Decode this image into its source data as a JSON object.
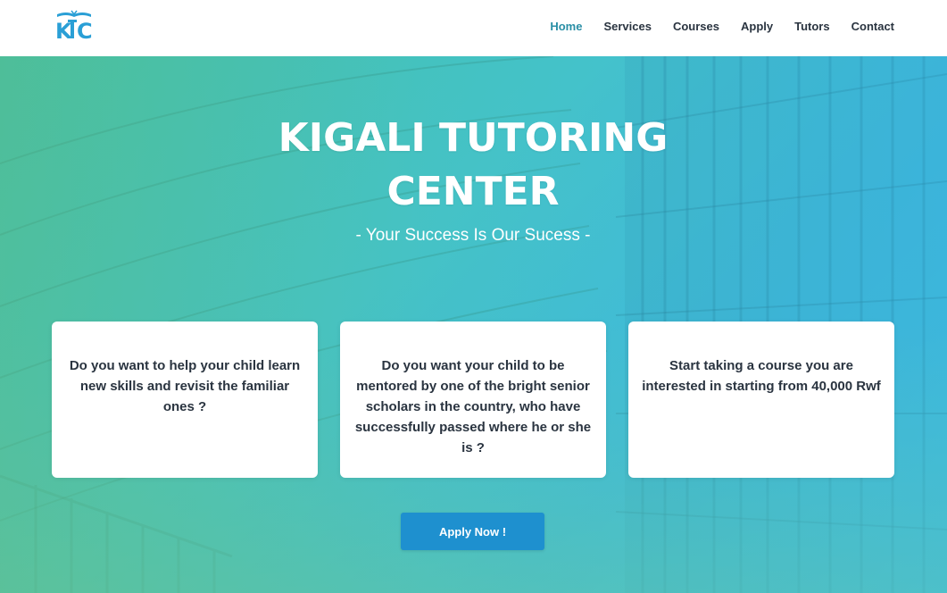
{
  "header": {
    "logo_text": "KTC",
    "nav": [
      {
        "label": "Home",
        "active": true
      },
      {
        "label": "Services",
        "active": false
      },
      {
        "label": "Courses",
        "active": false
      },
      {
        "label": "Apply",
        "active": false
      },
      {
        "label": "Tutors",
        "active": false
      },
      {
        "label": "Contact",
        "active": false
      }
    ]
  },
  "hero": {
    "title_line1": "KIGALI TUTORING",
    "title_line2": "CENTER",
    "subtitle": "- Your Success Is Our Sucess -",
    "cards": [
      {
        "text": "Do you want to help your child learn new skills and revisit the familiar ones ?"
      },
      {
        "text": "Do you want your child to be mentored by one of the bright senior scholars in the country, who have successfully passed where he or she is ?"
      },
      {
        "text": "Start taking a course you are interested in starting from 40,000 Rwf"
      }
    ],
    "apply_button": "Apply Now !"
  },
  "colors": {
    "accent": "#2a8fa6",
    "button": "#1e90cf",
    "nav_text": "#2a3440"
  }
}
